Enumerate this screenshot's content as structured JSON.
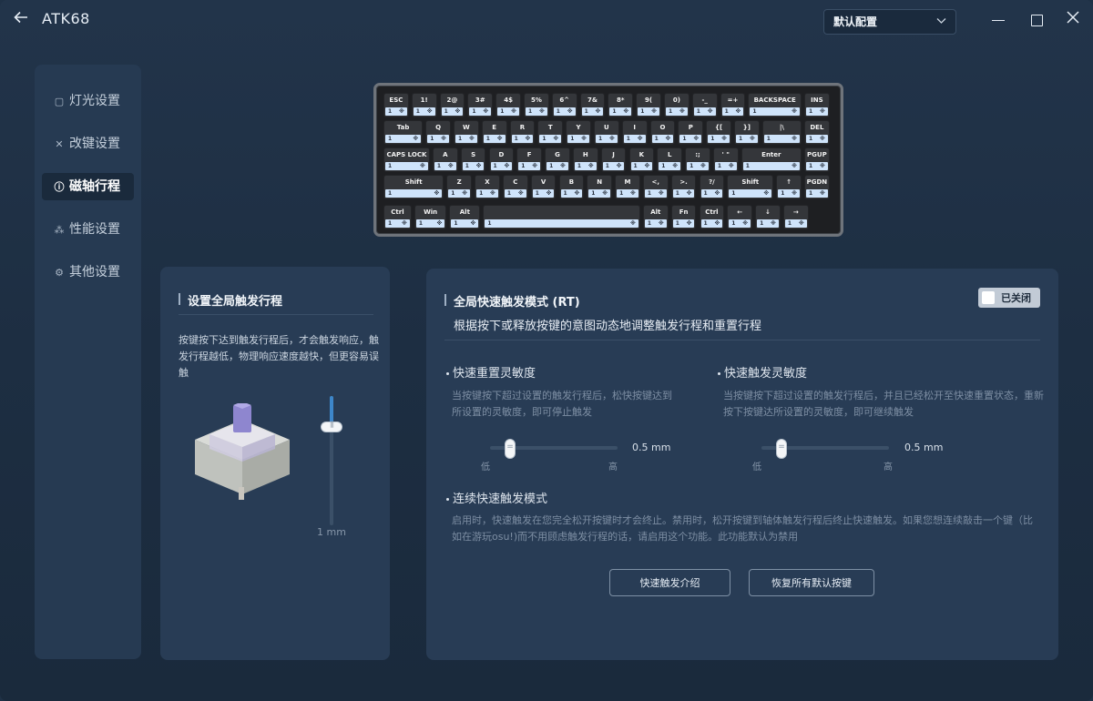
{
  "titlebar": {
    "app_title": "ATK68",
    "profile_select": "默认配置"
  },
  "sidebar": {
    "items": [
      {
        "label": "灯光设置",
        "icon": "lighting-icon"
      },
      {
        "label": "改键设置",
        "icon": "remap-icon"
      },
      {
        "label": "磁轴行程",
        "icon": "travel-icon"
      },
      {
        "label": "性能设置",
        "icon": "performance-icon"
      },
      {
        "label": "其他设置",
        "icon": "settings-gear-icon"
      }
    ],
    "active_index": 2
  },
  "keyboard": {
    "key_value": "1",
    "key_mark": "※",
    "rows": [
      [
        "ESC",
        "1!",
        "2@",
        "3#",
        "4$",
        "5%",
        "6^",
        "7&",
        "8*",
        "9(",
        "0)",
        "-_",
        "=+",
        "BACKSPACE",
        "INS"
      ],
      [
        "Tab",
        "Q",
        "W",
        "E",
        "R",
        "T",
        "Y",
        "U",
        "I",
        "O",
        "P",
        "{[",
        "}]",
        "|\\",
        "DEL"
      ],
      [
        "CAPS LOCK",
        "A",
        "S",
        "D",
        "F",
        "G",
        "H",
        "J",
        "K",
        "L",
        ":;",
        "' \"",
        "Enter",
        "PGUP"
      ],
      [
        "Shift",
        "Z",
        "X",
        "C",
        "V",
        "B",
        "N",
        "M",
        "<,",
        ">.",
        "?/",
        "Shift",
        "↑",
        "PGDN"
      ],
      [
        "Ctrl",
        "Win",
        "Alt",
        "",
        "Alt",
        "Fn",
        "Ctrl",
        "←",
        "↓",
        "→"
      ]
    ]
  },
  "left_panel": {
    "title": "设置全局触发行程",
    "description": "按键按下达到触发行程后，才会触发响应，触发行程越低，物理响应速度越快，但更容易误触",
    "travel_value": "1 mm",
    "travel_fraction": 0.24
  },
  "right_panel": {
    "title": "全局快速触发模式 (RT)",
    "subtitle": "根据按下或释放按键的意图动态地调整触发行程和重置行程",
    "toggle_label": "已关闭",
    "reset_sensitivity": {
      "title": "快速重置灵敏度",
      "description": "当按键按下超过设置的触发行程后，松快按键达到所设置的灵敏度，即可停止触发",
      "value": "0.5 mm",
      "low": "低",
      "high": "高",
      "fraction": 0.1
    },
    "trigger_sensitivity": {
      "title": "快速触发灵敏度",
      "description": "当按键按下超过设置的触发行程后，并且已经松开至快速重置状态，重新按下按键达所设置的灵敏度，即可继续触发",
      "value": "0.5 mm",
      "low": "低",
      "high": "高",
      "fraction": 0.1
    },
    "continuous": {
      "title": "连续快速触发模式",
      "description": "启用时，快速触发在您完全松开按键时才会终止。禁用时，松开按键到轴体触发行程后终止快速触发。如果您想连续敲击一个键（比如在游玩osu!)而不用顾虑触发行程的话，请启用这个功能。此功能默认为禁用"
    },
    "buttons": {
      "intro": "快速触发介绍",
      "restore": "恢复所有默认按键"
    }
  }
}
